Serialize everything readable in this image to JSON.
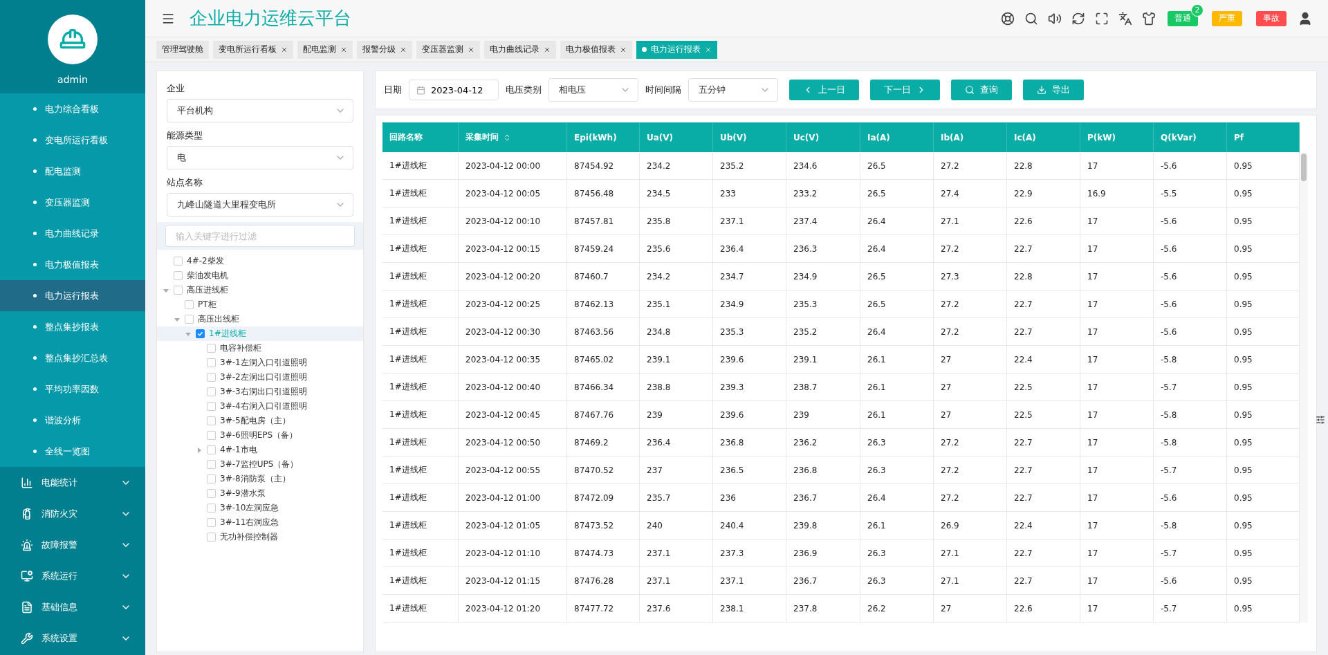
{
  "sidebar": {
    "user": "admin",
    "items": [
      {
        "kind": "sub",
        "label": "电力综合看板",
        "selected": false
      },
      {
        "kind": "sub",
        "label": "变电所运行看板",
        "selected": false
      },
      {
        "kind": "sub",
        "label": "配电监测",
        "selected": false
      },
      {
        "kind": "sub",
        "label": "变压器监测",
        "selected": false
      },
      {
        "kind": "sub",
        "label": "电力曲线记录",
        "selected": false
      },
      {
        "kind": "sub",
        "label": "电力极值报表",
        "selected": false
      },
      {
        "kind": "sub",
        "label": "电力运行报表",
        "selected": true
      },
      {
        "kind": "sub",
        "label": "整点集抄报表",
        "selected": false
      },
      {
        "kind": "sub",
        "label": "整点集抄汇总表",
        "selected": false
      },
      {
        "kind": "sub",
        "label": "平均功率因数",
        "selected": false
      },
      {
        "kind": "sub",
        "label": "谐波分析",
        "selected": false
      },
      {
        "kind": "sub",
        "label": "全线一览图",
        "selected": false
      },
      {
        "kind": "group",
        "label": "电能统计",
        "selected": false
      },
      {
        "kind": "group",
        "label": "消防火灾",
        "selected": false
      },
      {
        "kind": "group",
        "label": "故障报警",
        "selected": false
      },
      {
        "kind": "group",
        "label": "系统运行",
        "selected": false
      },
      {
        "kind": "group",
        "label": "基础信息",
        "selected": false
      },
      {
        "kind": "group",
        "label": "系统设置",
        "selected": false
      }
    ]
  },
  "header": {
    "title": "企业电力运维云平台",
    "alerts": [
      {
        "label": "普通",
        "color": "#19c764",
        "count": "2"
      },
      {
        "label": "严重",
        "color": "#ffb800"
      },
      {
        "label": "事故",
        "color": "#ff4d4f"
      }
    ]
  },
  "tabs": [
    {
      "label": "管理驾驶舱",
      "selected": false,
      "closable": false
    },
    {
      "label": "变电所运行看板",
      "selected": false,
      "closable": true
    },
    {
      "label": "配电监测",
      "selected": false,
      "closable": true
    },
    {
      "label": "报警分级",
      "selected": false,
      "closable": true
    },
    {
      "label": "变压器监测",
      "selected": false,
      "closable": true
    },
    {
      "label": "电力曲线记录",
      "selected": false,
      "closable": true
    },
    {
      "label": "电力极值报表",
      "selected": false,
      "closable": true
    },
    {
      "label": "电力运行报表",
      "selected": true,
      "closable": true
    }
  ],
  "filter": {
    "fields": [
      {
        "label": "企业",
        "value": "平台机构"
      },
      {
        "label": "能源类型",
        "value": "电"
      },
      {
        "label": "站点名称",
        "value": "九峰山隧道大里程变电所"
      }
    ],
    "search": {
      "placeholder": "输入关键字进行过滤"
    },
    "tree": [
      {
        "label": "4#-2柴发",
        "checked": false,
        "selected": false
      },
      {
        "label": "柴油发电机",
        "checked": false,
        "selected": false
      },
      {
        "label": "高压进线柜",
        "checked": false,
        "selected": false,
        "expanded": true,
        "children": [
          {
            "label": "PT柜",
            "checked": false,
            "selected": false
          },
          {
            "label": "高压出线柜",
            "checked": false,
            "selected": false,
            "expanded": true,
            "children": [
              {
                "label": "1#进线柜",
                "checked": true,
                "selected": true,
                "expanded": true,
                "children": [
                  {
                    "label": "电容补偿柜",
                    "checked": false,
                    "selected": false
                  },
                  {
                    "label": "3#-1左洞入口引道照明",
                    "checked": false,
                    "selected": false
                  },
                  {
                    "label": "3#-2左洞出口引道照明",
                    "checked": false,
                    "selected": false
                  },
                  {
                    "label": "3#-3右洞出口引道照明",
                    "checked": false,
                    "selected": false
                  },
                  {
                    "label": "3#-4右洞入口引道照明",
                    "checked": false,
                    "selected": false
                  },
                  {
                    "label": "3#-5配电房（主）",
                    "checked": false,
                    "selected": false
                  },
                  {
                    "label": "3#-6照明EPS（备）",
                    "checked": false,
                    "selected": false
                  },
                  {
                    "label": "4#-1市电",
                    "checked": false,
                    "selected": false,
                    "expanded": false
                  },
                  {
                    "label": "3#-7监控UPS（备）",
                    "checked": false,
                    "selected": false
                  },
                  {
                    "label": "3#-8消防泵（主）",
                    "checked": false,
                    "selected": false
                  },
                  {
                    "label": "3#-9潜水泵",
                    "checked": false,
                    "selected": false
                  },
                  {
                    "label": "3#-10左洞应急",
                    "checked": false,
                    "selected": false
                  },
                  {
                    "label": "3#-11右洞应急",
                    "checked": false,
                    "selected": false
                  },
                  {
                    "label": "无功补偿控制器",
                    "checked": false,
                    "selected": false
                  }
                ]
              }
            ]
          }
        ]
      }
    ]
  },
  "toolbar": {
    "date": {
      "label": "日期",
      "value": "2023-04-12"
    },
    "selects": [
      {
        "label": "电压类别",
        "value": "相电压"
      },
      {
        "label": "时间间隔",
        "value": "五分钟"
      }
    ],
    "buttons": [
      {
        "kind": "prev",
        "label": "上一日"
      },
      {
        "kind": "next",
        "label": "下一日"
      },
      {
        "kind": "search",
        "label": "查询"
      },
      {
        "kind": "export",
        "label": "导出"
      }
    ]
  },
  "table": {
    "columns": [
      {
        "label": "回路名称",
        "sortable": false
      },
      {
        "label": "采集时间",
        "sortable": true
      },
      {
        "label": "Epi(kWh)",
        "sortable": false
      },
      {
        "label": "Ua(V)",
        "sortable": false
      },
      {
        "label": "Ub(V)",
        "sortable": false
      },
      {
        "label": "Uc(V)",
        "sortable": false
      },
      {
        "label": "Ia(A)",
        "sortable": false
      },
      {
        "label": "Ib(A)",
        "sortable": false
      },
      {
        "label": "Ic(A)",
        "sortable": false
      },
      {
        "label": "P(kW)",
        "sortable": false
      },
      {
        "label": "Q(kVar)",
        "sortable": false
      },
      {
        "label": "Pf",
        "sortable": false
      }
    ],
    "rows": [
      [
        "1#进线柜",
        "2023-04-12 00:00",
        "87454.92",
        "234.2",
        "235.2",
        "234.6",
        "26.5",
        "27.2",
        "22.8",
        "17",
        "-5.6",
        "0.95"
      ],
      [
        "1#进线柜",
        "2023-04-12 00:05",
        "87456.48",
        "234.5",
        "233",
        "233.2",
        "26.5",
        "27.4",
        "22.9",
        "16.9",
        "-5.5",
        "0.95"
      ],
      [
        "1#进线柜",
        "2023-04-12 00:10",
        "87457.81",
        "235.8",
        "237.1",
        "237.4",
        "26.4",
        "27.1",
        "22.6",
        "17",
        "-5.6",
        "0.95"
      ],
      [
        "1#进线柜",
        "2023-04-12 00:15",
        "87459.24",
        "235.6",
        "236.4",
        "236.3",
        "26.4",
        "27.2",
        "22.7",
        "17",
        "-5.6",
        "0.95"
      ],
      [
        "1#进线柜",
        "2023-04-12 00:20",
        "87460.7",
        "234.2",
        "234.7",
        "234.9",
        "26.5",
        "27.3",
        "22.8",
        "17",
        "-5.6",
        "0.95"
      ],
      [
        "1#进线柜",
        "2023-04-12 00:25",
        "87462.13",
        "235.1",
        "234.9",
        "235.3",
        "26.5",
        "27.2",
        "22.7",
        "17",
        "-5.6",
        "0.95"
      ],
      [
        "1#进线柜",
        "2023-04-12 00:30",
        "87463.56",
        "234.8",
        "235.3",
        "235.2",
        "26.4",
        "27.2",
        "22.7",
        "17",
        "-5.6",
        "0.95"
      ],
      [
        "1#进线柜",
        "2023-04-12 00:35",
        "87465.02",
        "239.1",
        "239.6",
        "239.1",
        "26.1",
        "27",
        "22.4",
        "17",
        "-5.8",
        "0.95"
      ],
      [
        "1#进线柜",
        "2023-04-12 00:40",
        "87466.34",
        "238.8",
        "239.3",
        "238.7",
        "26.1",
        "27",
        "22.5",
        "17",
        "-5.7",
        "0.95"
      ],
      [
        "1#进线柜",
        "2023-04-12 00:45",
        "87467.76",
        "239",
        "239.6",
        "239",
        "26.1",
        "27",
        "22.5",
        "17",
        "-5.8",
        "0.95"
      ],
      [
        "1#进线柜",
        "2023-04-12 00:50",
        "87469.2",
        "236.4",
        "236.8",
        "236.2",
        "26.3",
        "27.2",
        "22.7",
        "17",
        "-5.8",
        "0.95"
      ],
      [
        "1#进线柜",
        "2023-04-12 00:55",
        "87470.52",
        "237",
        "236.5",
        "236.8",
        "26.3",
        "27.2",
        "22.7",
        "17",
        "-5.7",
        "0.95"
      ],
      [
        "1#进线柜",
        "2023-04-12 01:00",
        "87472.09",
        "235.7",
        "236",
        "236.7",
        "26.4",
        "27.2",
        "22.7",
        "17",
        "-5.6",
        "0.95"
      ],
      [
        "1#进线柜",
        "2023-04-12 01:05",
        "87473.52",
        "240",
        "240.4",
        "239.8",
        "26.1",
        "26.9",
        "22.4",
        "17",
        "-5.8",
        "0.95"
      ],
      [
        "1#进线柜",
        "2023-04-12 01:10",
        "87474.73",
        "237.1",
        "237.3",
        "236.9",
        "26.3",
        "27.1",
        "22.7",
        "17",
        "-5.7",
        "0.95"
      ],
      [
        "1#进线柜",
        "2023-04-12 01:15",
        "87476.28",
        "237.1",
        "237.1",
        "236.7",
        "26.3",
        "27.1",
        "22.7",
        "17",
        "-5.6",
        "0.95"
      ],
      [
        "1#进线柜",
        "2023-04-12 01:20",
        "87477.72",
        "237.6",
        "238.1",
        "237.8",
        "26.2",
        "27",
        "22.6",
        "17",
        "-5.7",
        "0.95"
      ]
    ]
  }
}
